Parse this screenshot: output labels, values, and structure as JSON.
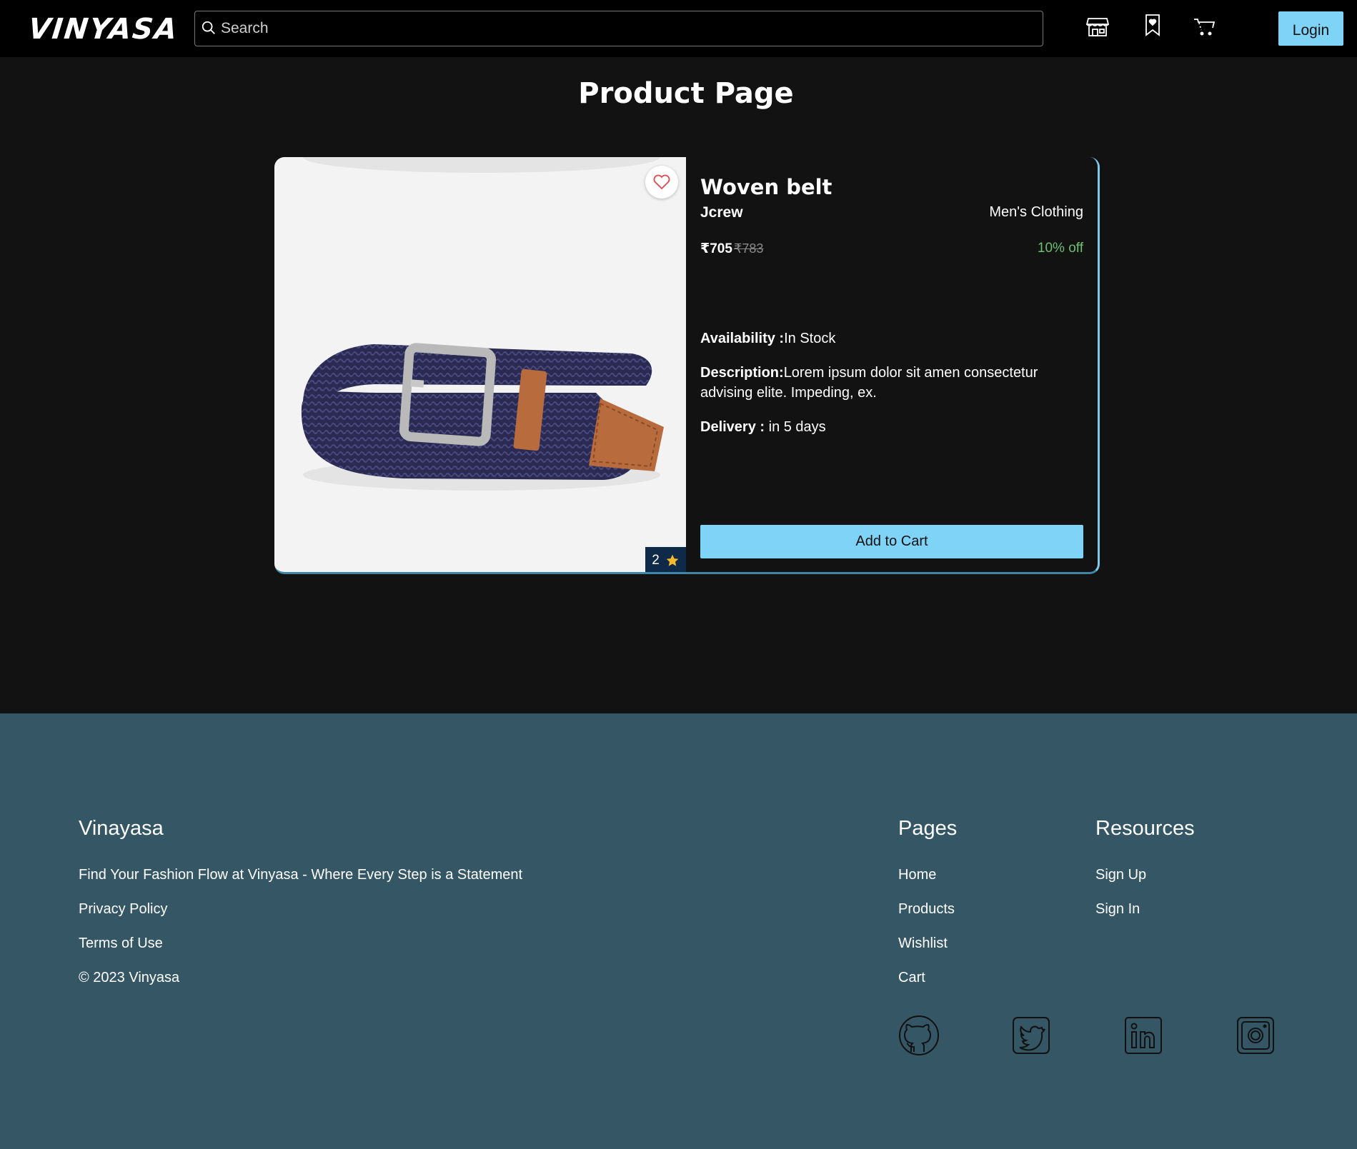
{
  "header": {
    "logo": "VINYASA",
    "search_placeholder": "Search",
    "icons": [
      "store-icon",
      "wishlist-bookmark-icon",
      "cart-icon"
    ],
    "login_label": "Login"
  },
  "page_title": "Product Page",
  "product": {
    "name": "Woven belt",
    "brand": "Jcrew",
    "category": "Men's Clothing",
    "price": "₹705",
    "mrp": "₹783",
    "discount": "10% off",
    "availability_label": "Availability :",
    "availability_value": "In Stock",
    "description_label": "Description:",
    "description_value": "Lorem ipsum dolor sit amen consectetur advising elite. Impeding, ex.",
    "delivery_label": "Delivery :",
    "delivery_value": " in 5 days",
    "rating": "2",
    "add_to_cart_label": "Add to Cart"
  },
  "footer": {
    "brand": "Vinayasa",
    "tagline": "Find Your Fashion Flow at Vinyasa - Where Every Step is a Statement",
    "privacy": "Privacy Policy",
    "terms": "Terms of Use",
    "copyright": "© 2023 Vinyasa",
    "pages_heading": "Pages",
    "pages": [
      "Home",
      "Products",
      "Wishlist",
      "Cart"
    ],
    "resources_heading": "Resources",
    "resources": [
      "Sign Up",
      "Sign In"
    ],
    "social": [
      "github-icon",
      "twitter-icon",
      "linkedin-icon",
      "instagram-icon"
    ]
  },
  "colors": {
    "accent": "#7fd3f7",
    "background": "#121212",
    "footer": "#355665",
    "discount": "#6cc070"
  }
}
